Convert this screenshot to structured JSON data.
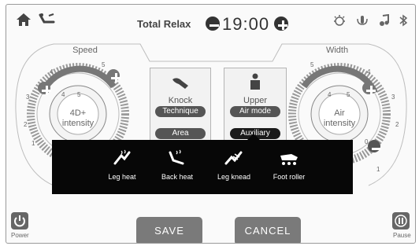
{
  "header": {
    "mode_label": "Total Relax",
    "timer": "19:00",
    "left_icons": [
      "home-icon",
      "recline-icon"
    ],
    "right_icons": [
      "light-icon",
      "voice-icon",
      "music-icon",
      "bluetooth-icon"
    ]
  },
  "speed_dial": {
    "title": "Speed",
    "center_line1": "4D+",
    "center_line2": "intensity",
    "scale": [
      "1",
      "2",
      "3",
      "4",
      "5"
    ],
    "inner_scale": [
      "4",
      "5"
    ]
  },
  "width_dial": {
    "title": "Width",
    "center_line1": "Air",
    "center_line2": "intensity",
    "scale": [
      "1",
      "2",
      "3",
      "4",
      "5"
    ],
    "inner_scale": [
      "4",
      "5",
      "0"
    ]
  },
  "technique_panel": {
    "label": "Knock",
    "chip": "Technique",
    "chip2": "Area",
    "icon": "massage-hand-icon"
  },
  "air_panel": {
    "label": "Upper",
    "chip": "Air mode",
    "chip2": "Auxiliary",
    "icon": "person-icon"
  },
  "auxiliary_popup": {
    "items": [
      {
        "label": "Leg heat",
        "icon": "leg-heat-icon"
      },
      {
        "label": "Back heat",
        "icon": "back-heat-icon"
      },
      {
        "label": "Leg knead",
        "icon": "leg-knead-icon"
      },
      {
        "label": "Foot roller",
        "icon": "foot-roller-icon"
      }
    ]
  },
  "footer": {
    "save": "SAVE",
    "cancel": "CANCEL",
    "power": "Power",
    "pause": "Pause"
  },
  "colors": {
    "popup_bg": "#070707",
    "button_gray": "#7a7a7a",
    "chip_dark": "#1a1a1a"
  }
}
